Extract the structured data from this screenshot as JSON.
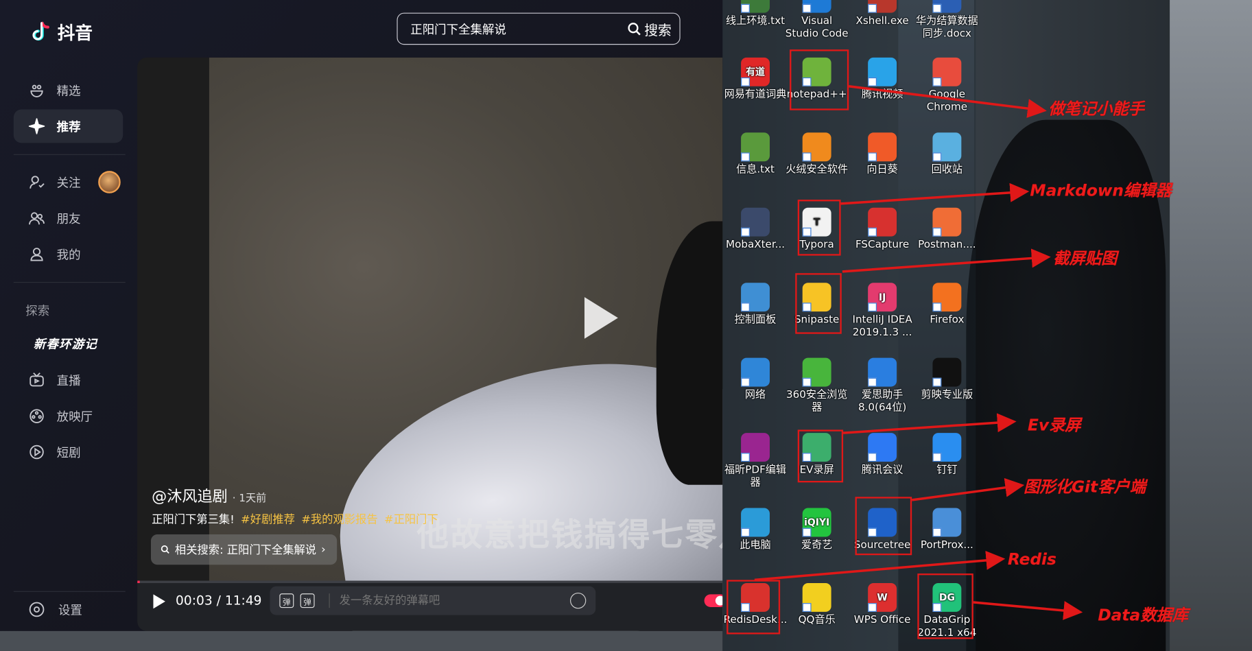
{
  "app": {
    "name": "抖音"
  },
  "search": {
    "value": "正阳门下全集解说",
    "button": "搜索"
  },
  "sidebar": {
    "top": [
      {
        "label": "精选",
        "icon": "featured-icon"
      },
      {
        "label": "推荐",
        "icon": "sparkle-icon",
        "active": true
      }
    ],
    "social": [
      {
        "label": "关注",
        "icon": "follow-icon"
      },
      {
        "label": "朋友",
        "icon": "friends-icon"
      },
      {
        "label": "我的",
        "icon": "profile-icon"
      }
    ],
    "explore_title": "探索",
    "festival": "新春环游记",
    "more": [
      {
        "label": "直播",
        "icon": "live-tv-icon"
      },
      {
        "label": "放映厅",
        "icon": "cinema-icon"
      },
      {
        "label": "短剧",
        "icon": "short-drama-icon"
      }
    ],
    "settings": "设置"
  },
  "video": {
    "author": "@沐风追剧",
    "posted": "· 1天前",
    "caption": "正阳门下第三集!",
    "tags": [
      "#好剧推荐",
      "#我的观影报告",
      "#正阳门下"
    ],
    "subtitle": "他故意把钱搞得七零八",
    "related_search": "相关搜索: 正阳门下全集解说",
    "current_time": "00:03",
    "separator": "/",
    "duration": "11:49",
    "progress": 0.004,
    "danmaku_placeholder": "发一条友好的弹幕吧",
    "danmaku_glyph": "弹"
  },
  "desktop": {
    "icons": [
      {
        "label": "线上环境.txt",
        "color": "#3d7a3a"
      },
      {
        "label": "Visual Studio Code",
        "color": "#1e7ad6"
      },
      {
        "label": "Xshell.exe",
        "color": "#b8372c"
      },
      {
        "label": "华为结算数据同步.docx",
        "color": "#2b5fb4"
      },
      {
        "label": "网易有道词典",
        "color": "#e02727",
        "glyph": "有道"
      },
      {
        "label": "notepad++",
        "color": "#6fb33c"
      },
      {
        "label": "腾讯视频",
        "color": "#29a3e8"
      },
      {
        "label": "Google Chrome",
        "color": "#e84c3d"
      },
      {
        "label": "信息.txt",
        "color": "#5a9a3c"
      },
      {
        "label": "火绒安全软件",
        "color": "#f08a1d"
      },
      {
        "label": "向日葵",
        "color": "#f05a28"
      },
      {
        "label": "回收站",
        "color": "#5ab0e0"
      },
      {
        "label": "MobaXter...",
        "color": "#3b4a6b"
      },
      {
        "label": "Typora",
        "color": "#f2f2f2",
        "glyph": "T"
      },
      {
        "label": "FSCapture",
        "color": "#d7312f"
      },
      {
        "label": "Postman....",
        "color": "#f06d36"
      },
      {
        "label": "控制面板",
        "color": "#3f8fd4"
      },
      {
        "label": "Snipaste",
        "color": "#f7c325"
      },
      {
        "label": "IntelliJ IDEA 2019.1.3 ...",
        "color": "#e33b6e",
        "glyph": "IJ"
      },
      {
        "label": "Firefox",
        "color": "#f3711f"
      },
      {
        "label": "网络",
        "color": "#2f86d8"
      },
      {
        "label": "360安全浏览器",
        "color": "#48b53c"
      },
      {
        "label": "爱思助手8.0(64位)",
        "color": "#2a7ee0"
      },
      {
        "label": "剪映专业版",
        "color": "#111111"
      },
      {
        "label": "福昕PDF编辑器",
        "color": "#9a2590"
      },
      {
        "label": "EV录屏",
        "color": "#3cae6c"
      },
      {
        "label": "腾讯会议",
        "color": "#2d79f3"
      },
      {
        "label": "钉钉",
        "color": "#2a8ef0"
      },
      {
        "label": "此电脑",
        "color": "#2b9bd8"
      },
      {
        "label": "爱奇艺",
        "color": "#23c43f",
        "glyph": "iQIYI"
      },
      {
        "label": "Sourcetree",
        "color": "#1f62c9"
      },
      {
        "label": "PortProx...",
        "color": "#4a8fd8"
      },
      {
        "label": "RedisDesk...",
        "color": "#d9322d"
      },
      {
        "label": "QQ音乐",
        "color": "#f2cf1f"
      },
      {
        "label": "WPS Office",
        "color": "#dd2f2f",
        "glyph": "W"
      },
      {
        "label": "DataGrip 2021.1 x64",
        "color": "#21c27a",
        "glyph": "DG"
      }
    ],
    "annotations": [
      "做笔记小能手",
      "Markdown编辑器",
      "截屏贴图",
      "Ev录屏",
      "图形化Git客户端",
      "Redis",
      "Data数据库"
    ],
    "annotation_color": "#e01818"
  },
  "colors": {
    "accent": "#fe2c55",
    "tag": "#f6c343"
  }
}
